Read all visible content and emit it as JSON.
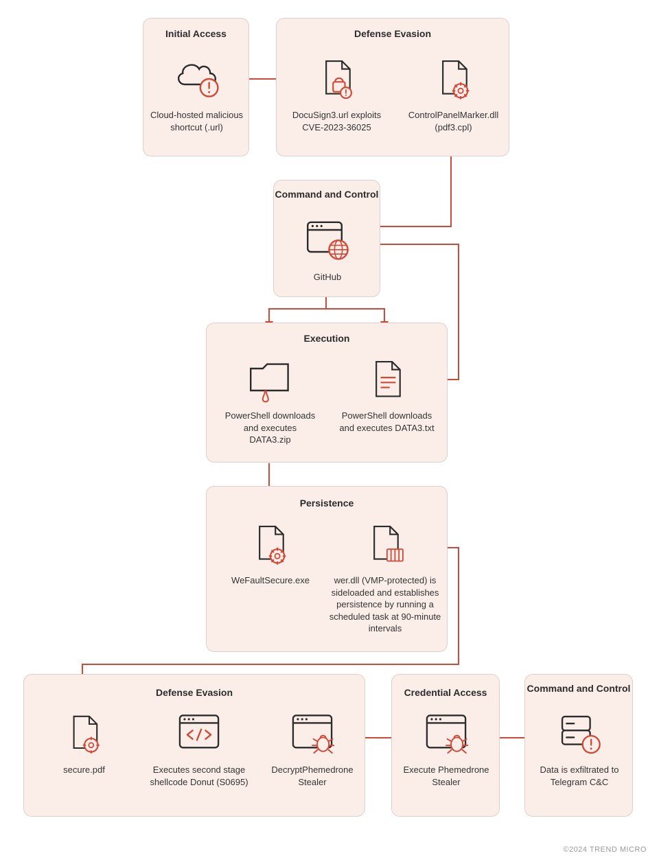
{
  "footer": "©2024 TREND MICRO",
  "boxes": {
    "initial_access": {
      "title": "Initial Access"
    },
    "defense_evasion_1": {
      "title": "Defense Evasion"
    },
    "c2_1": {
      "title": "Command and Control"
    },
    "execution": {
      "title": "Execution"
    },
    "persistence": {
      "title": "Persistence"
    },
    "defense_evasion_2": {
      "title": "Defense Evasion"
    },
    "credential_access": {
      "title": "Credential Access"
    },
    "c2_2": {
      "title": "Command and Control"
    }
  },
  "nodes": {
    "cloud_shortcut": "Cloud-hosted malicious shortcut (.url)",
    "docusign": "DocuSign3.url exploits CVE-2023-36025",
    "controlpanel": "ControlPanelMarker.dll (pdf3.cpl)",
    "github": "GitHub",
    "ps_zip": "PowerShell downloads and executes DATA3.zip",
    "ps_txt": "PowerShell downloads and executes DATA3.txt",
    "wefault": "WeFaultSecure.exe",
    "werdll": "wer.dll (VMP-protected) is sideloaded and establishes persistence  by running a scheduled task at 90-minute intervals",
    "securepdf": "secure.pdf",
    "donut": "Executes second stage shellcode Donut (S0695)",
    "decrypt": "DecryptPhemedrone Stealer",
    "execute_stealer": "Execute Phemedrone Stealer",
    "exfil": "Data is exfiltrated to Telegram C&C"
  }
}
